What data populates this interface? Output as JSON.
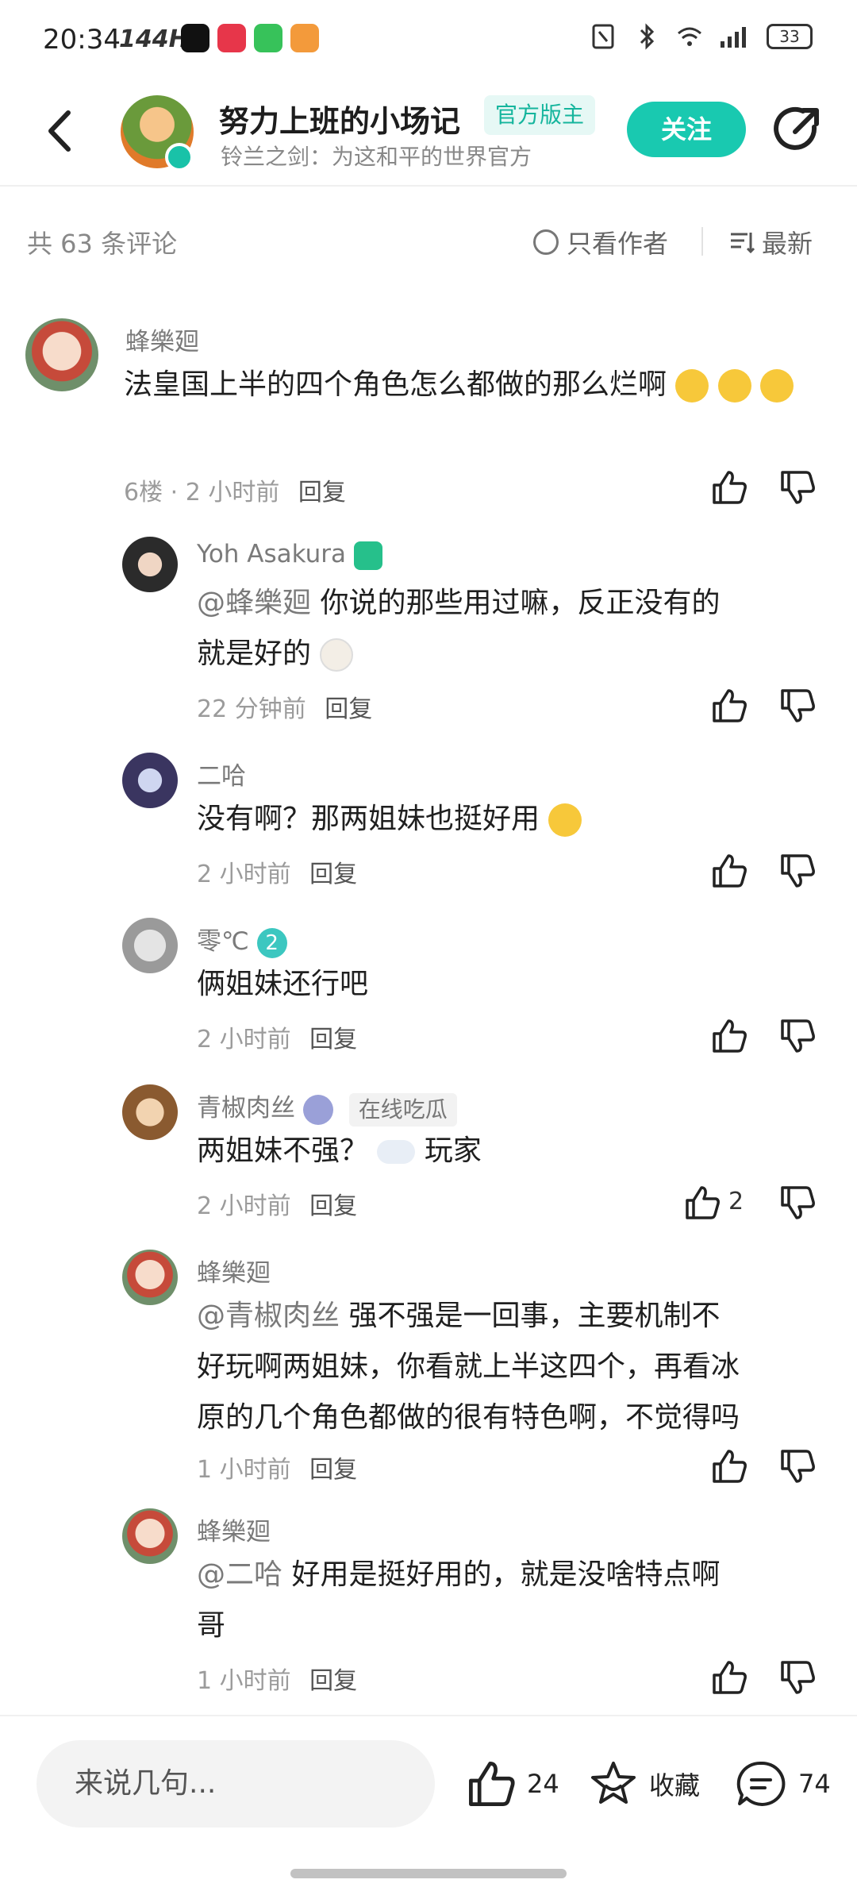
{
  "status_bar": {
    "time": "20:34",
    "refresh_rate": "144Hz",
    "battery": "33"
  },
  "header": {
    "title": "努力上班的小场记",
    "badge": "官方版主",
    "subtitle": "铃兰之剑：为这和平的世界官方",
    "follow_label": "关注"
  },
  "filter": {
    "count_label": "共 63 条评论",
    "only_author_label": "只看作者",
    "sort_label": "最新"
  },
  "comments": [
    {
      "name": "蜂樂廻",
      "text": "法皇国上半的四个角色怎么都做的那么烂啊",
      "floor": "6楼",
      "time": "2 小时前",
      "reply": "回复",
      "likes": ""
    },
    {
      "name": "Yoh Asakura",
      "mention": "@蜂樂廻",
      "text_line1": "你说的那些用过嘛，反正没有的",
      "text_line2": "就是好的",
      "time": "22 分钟前",
      "reply": "回复",
      "likes": ""
    },
    {
      "name": "二哈",
      "text": "没有啊？那两姐妹也挺好用",
      "time": "2 小时前",
      "reply": "回复",
      "likes": ""
    },
    {
      "name": "零℃",
      "level": "2",
      "text": "俩姐妹还行吧",
      "time": "2 小时前",
      "reply": "回复",
      "likes": ""
    },
    {
      "name": "青椒肉丝",
      "tag": "在线吃瓜",
      "text_before": "两姐妹不强？",
      "text_after": "玩家",
      "time": "2 小时前",
      "reply": "回复",
      "likes": "2"
    },
    {
      "name": "蜂樂廻",
      "mention": "@青椒肉丝",
      "text_line1": "强不强是一回事，主要机制不",
      "text_line2": "好玩啊两姐妹，你看就上半这四个，再看冰",
      "text_line3": "原的几个角色都做的很有特色啊，不觉得吗",
      "time": "1 小时前",
      "reply": "回复",
      "likes": ""
    },
    {
      "name": "蜂樂廻",
      "mention": "@二哈",
      "text_line1": "好用是挺好用的，就是没啥特点啊",
      "text_line2": "哥",
      "time": "1 小时前",
      "reply": "回复",
      "likes": ""
    }
  ],
  "bottom_bar": {
    "input_placeholder": "来说几句...",
    "likes": "24",
    "favorite_label": "收藏",
    "comments": "74"
  },
  "colors": {
    "accent": "#19c9b0",
    "badge_bg": "#e6f8f5",
    "badge_text": "#15b59d",
    "muted_text": "#9b9b9b"
  }
}
